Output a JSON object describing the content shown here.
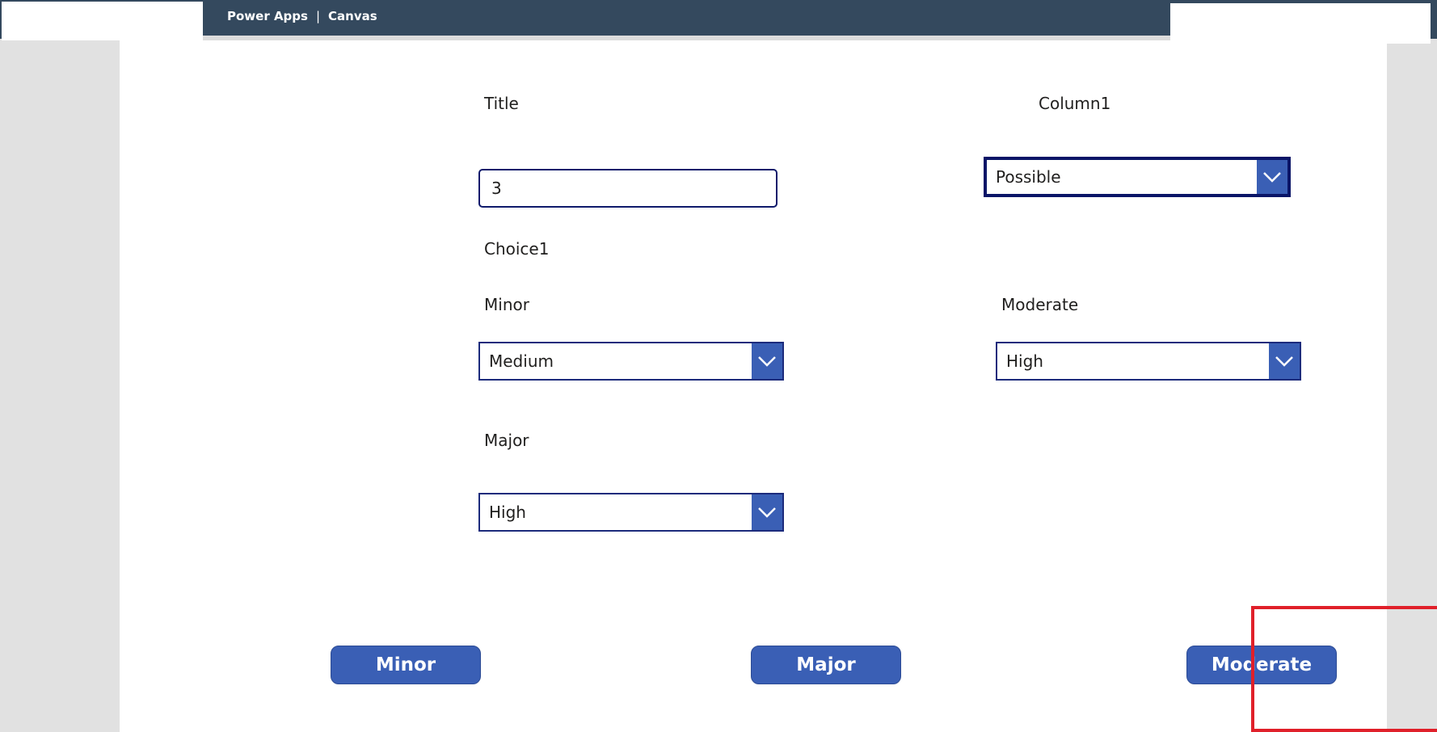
{
  "header": {
    "app_name": "Power Apps",
    "separator": "|",
    "section": "Canvas"
  },
  "form": {
    "title_label": "Title",
    "title_value": "3",
    "column1_label": "Column1",
    "column1_value": "Possible",
    "choice1_label": "Choice1",
    "minor_label": "Minor",
    "minor_value": "Medium",
    "moderate_label": "Moderate",
    "moderate_value": "High",
    "major_label": "Major",
    "major_value": "High"
  },
  "buttons": {
    "minor": "Minor",
    "major": "Major",
    "moderate": "Moderate"
  },
  "icons": {
    "dropdown": "chevron-down-icon"
  },
  "colors": {
    "header_bg": "#34495e",
    "accent": "#3a5fb5",
    "border": "#1c2b7c",
    "highlight": "#e0202a"
  }
}
